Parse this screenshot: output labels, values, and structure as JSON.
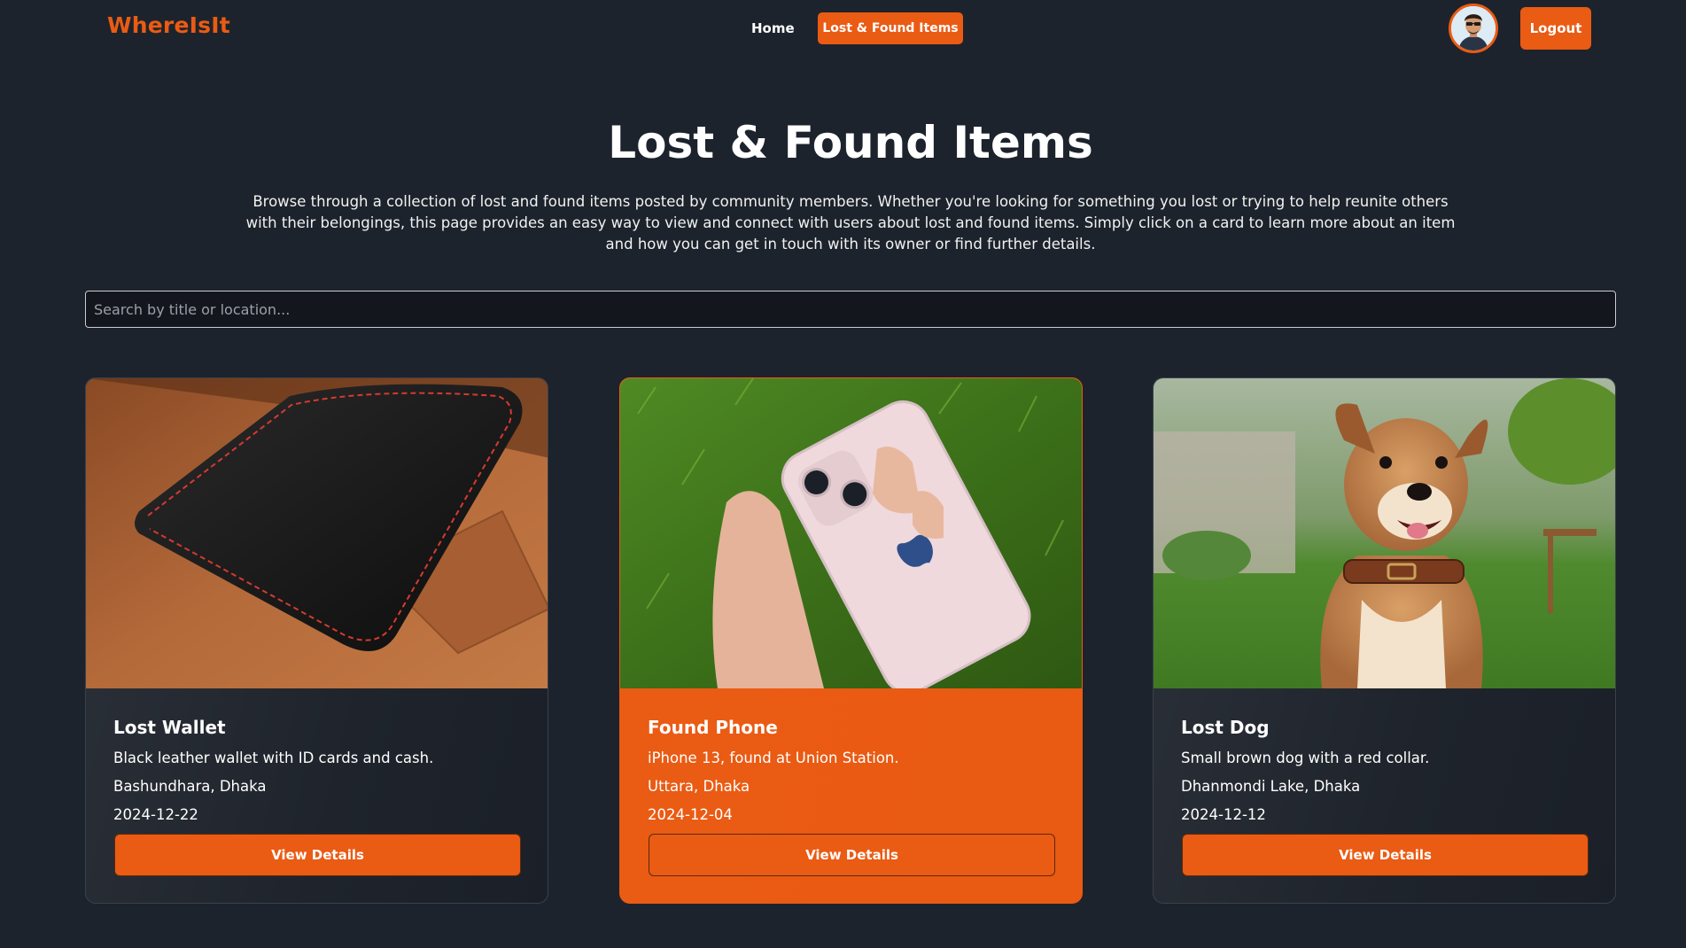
{
  "nav": {
    "brand": "WhereIsIt",
    "home": "Home",
    "lost_found": "Lost & Found Items",
    "logout": "Logout"
  },
  "hero": {
    "title": "Lost & Found Items",
    "description": "Browse through a collection of lost and found items posted by community members. Whether you're looking for something you lost or trying to help reunite others with their belongings, this page provides an easy way to view and connect with users about lost and found items. Simply click on a card to learn more about an item and how you can get in touch with its owner or find further details."
  },
  "search": {
    "placeholder": "Search by title or location...",
    "value": ""
  },
  "cards": [
    {
      "title": "Lost Wallet",
      "description": "Black leather wallet with ID cards and cash.",
      "location": "Bashundhara, Dhaka",
      "date": "2024-12-22",
      "button": "View Details",
      "image": "wallet-photo"
    },
    {
      "title": "Found Phone",
      "description": "iPhone 13, found at Union Station.",
      "location": "Uttara, Dhaka",
      "date": "2024-12-04",
      "button": "View Details",
      "image": "phone-photo"
    },
    {
      "title": "Lost Dog",
      "description": "Small brown dog with a red collar.",
      "location": "Dhanmondi Lake, Dhaka",
      "date": "2024-12-12",
      "button": "View Details",
      "image": "dog-photo"
    }
  ],
  "colors": {
    "accent": "#ea5b14",
    "background": "#1d232c"
  }
}
